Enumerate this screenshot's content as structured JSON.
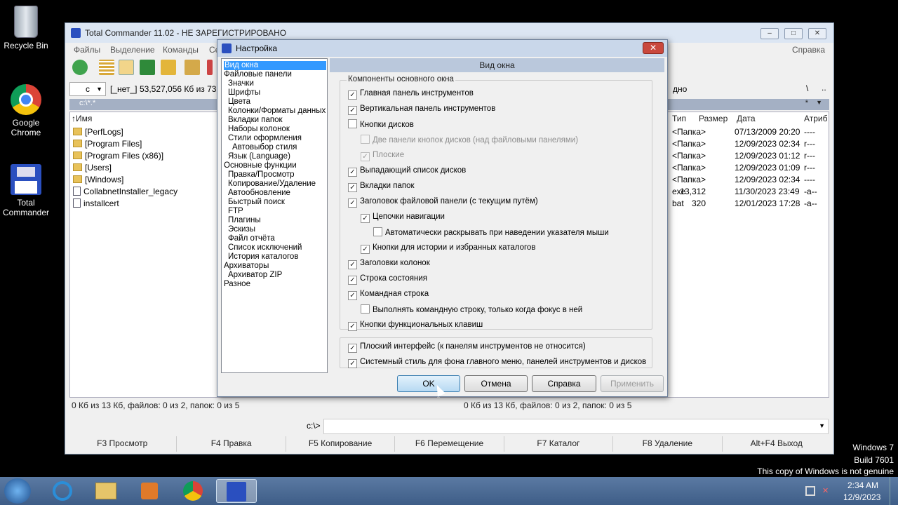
{
  "desktop": {
    "icons": [
      {
        "label": "Recycle Bin"
      },
      {
        "label": "Google Chrome"
      },
      {
        "label": "Total Commander"
      }
    ],
    "watermark": [
      "Windows 7",
      "Build 7601",
      "This copy of Windows is not genuine"
    ]
  },
  "main": {
    "title": "Total Commander 11.02 - НЕ ЗАРЕГИСТРИРОВАНО",
    "menu": [
      "Файлы",
      "Выделение",
      "Команды",
      "Се",
      "Справка"
    ],
    "drive": {
      "letter": "c",
      "label": "[_нет_]",
      "free": "53,527,056 Кб из 73,34",
      "right_tail": "дно",
      "right_path": "\\",
      "right_dots": ".."
    },
    "left_path": "c:\\*.*",
    "left_header": "↑Имя",
    "right_headers": [
      "Тип",
      "Размер",
      "Дата",
      "Атриб"
    ],
    "files": [
      {
        "name": "[PerfLogs]",
        "type": "",
        "size": "<Папка>",
        "date": "07/13/2009 20:20",
        "attr": "----"
      },
      {
        "name": "[Program Files]",
        "type": "",
        "size": "<Папка>",
        "date": "12/09/2023 02:34",
        "attr": "r---"
      },
      {
        "name": "[Program Files (x86)]",
        "type": "",
        "size": "<Папка>",
        "date": "12/09/2023 01:12",
        "attr": "r---"
      },
      {
        "name": "[Users]",
        "type": "",
        "size": "<Папка>",
        "date": "12/09/2023 01:09",
        "attr": "r---"
      },
      {
        "name": "[Windows]",
        "type": "",
        "size": "<Папка>",
        "date": "12/09/2023 02:34",
        "attr": "----"
      },
      {
        "name": "CollabnetInstaller_legacy",
        "type": "exe",
        "size": "13,312",
        "date": "11/30/2023 23:49",
        "attr": "-a--"
      },
      {
        "name": "installcert",
        "type": "bat",
        "size": "320",
        "date": "12/01/2023 17:28",
        "attr": "-a--"
      }
    ],
    "status_left": "0 Кб из 13 Кб, файлов: 0 из 2, папок: 0 из 5",
    "status_right": "0 Кб из 13 Кб, файлов: 0 из 2, папок: 0 из 5",
    "cmd_prompt": "c:\\>",
    "fkeys": [
      "F3 Просмотр",
      "F4 Правка",
      "F5 Копирование",
      "F6 Перемещение",
      "F7 Каталог",
      "F8 Удаление",
      "Alt+F4 Выход"
    ]
  },
  "dialog": {
    "title": "Настройка",
    "tree": [
      {
        "label": "Вид окна",
        "level": 0,
        "selected": true
      },
      {
        "label": "Файловые панели",
        "level": 0
      },
      {
        "label": "Значки",
        "level": 1
      },
      {
        "label": "Шрифты",
        "level": 1
      },
      {
        "label": "Цвета",
        "level": 1
      },
      {
        "label": "Колонки/Форматы данных",
        "level": 1
      },
      {
        "label": "Вкладки папок",
        "level": 1
      },
      {
        "label": "Наборы колонок",
        "level": 1
      },
      {
        "label": "Стили оформления",
        "level": 1
      },
      {
        "label": "Автовыбор стиля",
        "level": 2
      },
      {
        "label": "Язык (Language)",
        "level": 1
      },
      {
        "label": "Основные функции",
        "level": 0
      },
      {
        "label": "Правка/Просмотр",
        "level": 1
      },
      {
        "label": "Копирование/Удаление",
        "level": 1
      },
      {
        "label": "Автообновление",
        "level": 1
      },
      {
        "label": "Быстрый поиск",
        "level": 1
      },
      {
        "label": "FTP",
        "level": 1
      },
      {
        "label": "Плагины",
        "level": 1
      },
      {
        "label": "Эскизы",
        "level": 1
      },
      {
        "label": "Файл отчёта",
        "level": 1
      },
      {
        "label": "Список исключений",
        "level": 1
      },
      {
        "label": "История каталогов",
        "level": 1
      },
      {
        "label": "Архиваторы",
        "level": 0
      },
      {
        "label": "Архиватор ZIP",
        "level": 1
      },
      {
        "label": "Разное",
        "level": 0
      }
    ],
    "section_title": "Вид окна",
    "group_label": "Компоненты основного окна",
    "options": [
      {
        "label": "Главная панель инструментов",
        "checked": true,
        "indent": 0
      },
      {
        "label": "Вертикальная панель инструментов",
        "checked": true,
        "indent": 0
      },
      {
        "label": "Кнопки дисков",
        "checked": false,
        "indent": 0
      },
      {
        "label": "Две панели кнопок дисков (над файловыми панелями)",
        "checked": false,
        "indent": 1,
        "disabled": true
      },
      {
        "label": "Плоские",
        "checked": true,
        "indent": 1,
        "disabled": true
      },
      {
        "label": "Выпадающий список дисков",
        "checked": true,
        "indent": 0
      },
      {
        "label": "Вкладки папок",
        "checked": true,
        "indent": 0
      },
      {
        "label": "Заголовок файловой панели (с текущим путём)",
        "checked": true,
        "indent": 0
      },
      {
        "label": "Цепочки навигации",
        "checked": true,
        "indent": 1
      },
      {
        "label": "Автоматически раскрывать при наведении указателя мыши",
        "checked": false,
        "indent": 2
      },
      {
        "label": "Кнопки для истории и избранных каталогов",
        "checked": true,
        "indent": 1
      },
      {
        "label": "Заголовки колонок",
        "checked": true,
        "indent": 0
      },
      {
        "label": "Строка состояния",
        "checked": true,
        "indent": 0
      },
      {
        "label": "Командная строка",
        "checked": true,
        "indent": 0
      },
      {
        "label": "Выполнять командную строку, только когда фокус в ней",
        "checked": false,
        "indent": 1
      },
      {
        "label": "Кнопки функциональных клавиш",
        "checked": true,
        "indent": 0
      }
    ],
    "extra_options": [
      {
        "label": "Плоский интерфейс (к панелям инструментов не относится)",
        "checked": true
      },
      {
        "label": "Системный стиль для фона главного меню, панелей инструментов и дисков",
        "checked": true
      }
    ],
    "buttons": {
      "ok": "OK",
      "cancel": "Отмена",
      "help": "Справка",
      "apply": "Применить"
    }
  },
  "taskbar": {
    "time": "2:34 AM",
    "date": "12/9/2023"
  }
}
